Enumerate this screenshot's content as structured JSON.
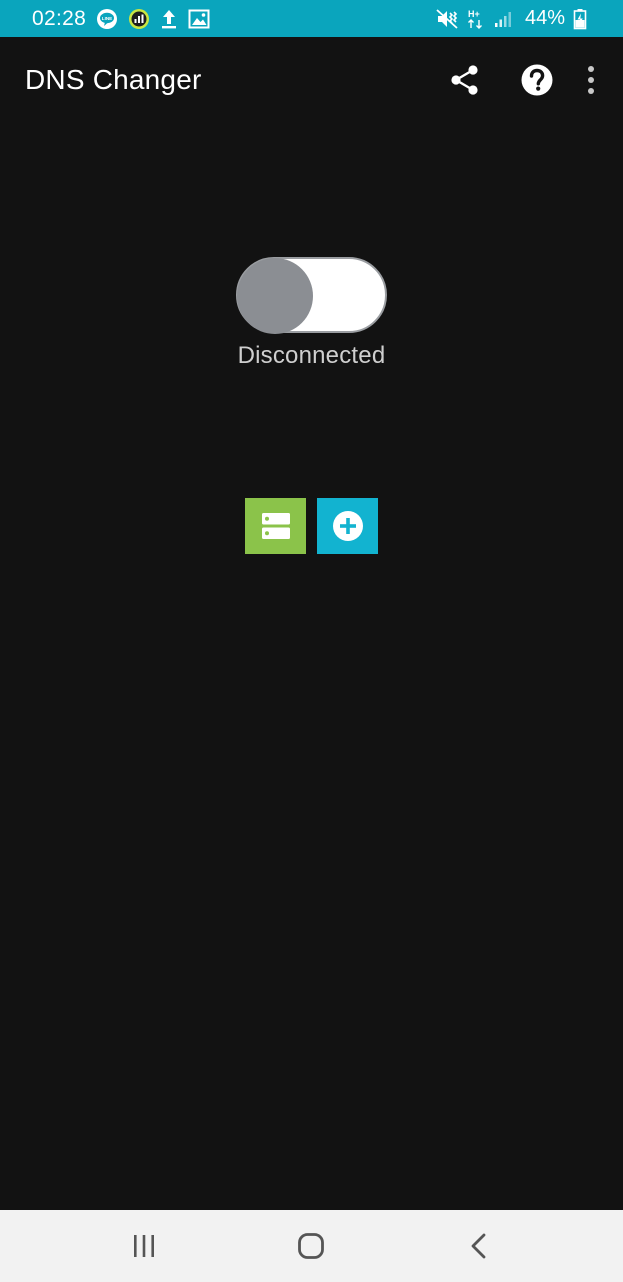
{
  "status_bar": {
    "time": "02:28",
    "battery": "44%",
    "network_type": "H+",
    "background_color": "#0aa5bd",
    "left_icons": [
      "line-icon",
      "chart-notification-icon",
      "upload-icon",
      "image-icon"
    ],
    "right_icons": [
      "mute-vibrate-icon",
      "network-hplus-icon",
      "signal-icon",
      "battery-charging-icon"
    ]
  },
  "toolbar": {
    "title": "DNS Changer",
    "actions": [
      "share-icon",
      "help-icon",
      "more-vert-icon"
    ]
  },
  "main": {
    "toggle_state": "off",
    "connection_status": "Disconnected",
    "server_list_color": "#8bc34a",
    "add_server_color": "#12b3d0"
  },
  "nav_bar": {
    "buttons": [
      "recent-apps-icon",
      "home-icon",
      "back-icon"
    ]
  },
  "colors": {
    "background": "#121212",
    "accent": "#0aa5bd"
  }
}
